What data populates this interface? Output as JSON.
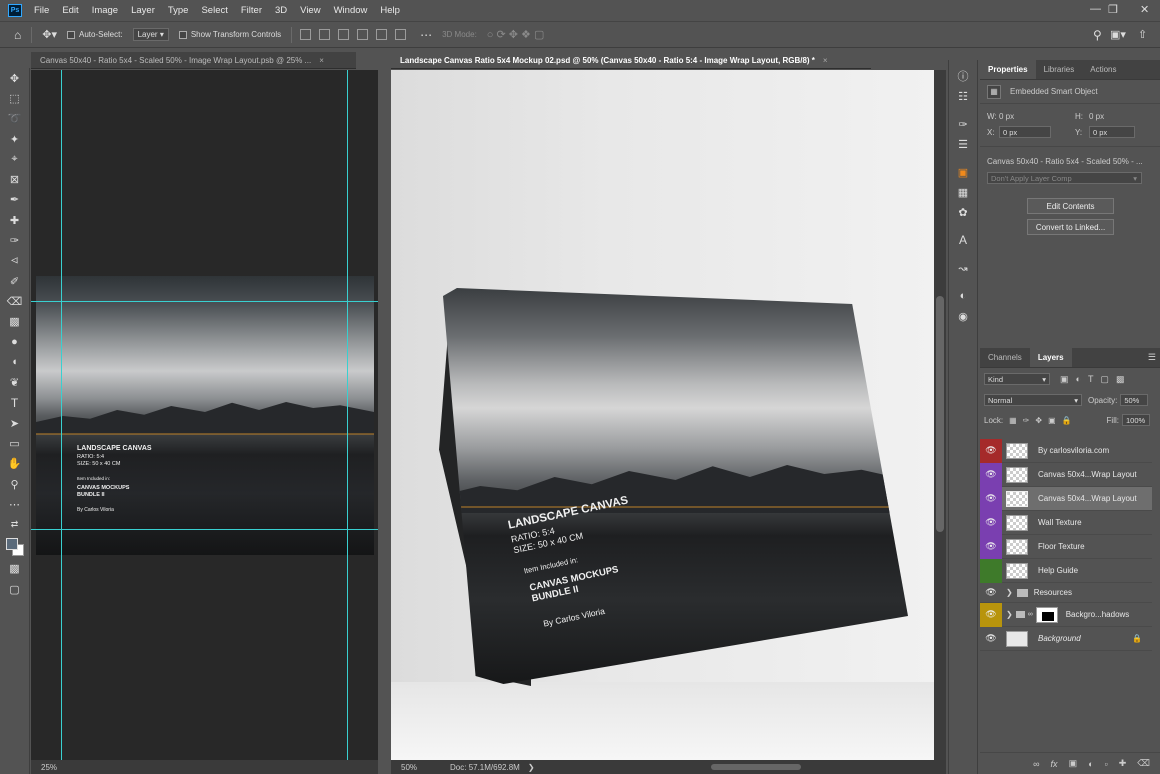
{
  "app": {
    "logo": "Ps"
  },
  "menu": [
    "File",
    "Edit",
    "Image",
    "Layer",
    "Type",
    "Select",
    "Filter",
    "3D",
    "View",
    "Window",
    "Help"
  ],
  "options": {
    "auto_select_label": "Auto-Select:",
    "auto_select_value": "Layer",
    "transform_label": "Show Transform Controls",
    "mode3d": "3D Mode:"
  },
  "doc_left": {
    "tab": "Canvas 50x40 - Ratio 5x4 - Scaled 50% - Image Wrap Layout.psb @ 25% ...",
    "zoom": "25%"
  },
  "doc_main": {
    "tab": "Landscape Canvas Ratio 5x4 Mockup 02.psd @ 50% (Canvas 50x40 - Ratio 5:4 - Image Wrap Layout, RGB/8) *",
    "zoom": "50%",
    "doc_size": "Doc: 57.1M/692.8M"
  },
  "artwork": {
    "title": "LANDSCAPE CANVAS",
    "ratio": "RATIO: 5:4",
    "size": "SIZE: 50 x 40 CM",
    "included": "Item Included in:",
    "bundle1": "CANVAS MOCKUPS",
    "bundle2": "BUNDLE II",
    "author": "By Carlos Viloria"
  },
  "properties": {
    "tabs": [
      "Properties",
      "Libraries",
      "Actions"
    ],
    "type": "Embedded Smart Object",
    "w_label": "W:",
    "w": "0 px",
    "h_label": "H:",
    "h": "0 px",
    "x_label": "X:",
    "x": "0 px",
    "y_label": "Y:",
    "y": "0 px",
    "file": "Canvas 50x40 - Ratio 5x4 - Scaled 50% - ...",
    "layer_comp": "Don't Apply Layer Comp",
    "edit_btn": "Edit Contents",
    "convert_btn": "Convert to Linked..."
  },
  "layers_panel": {
    "tabs": [
      "Channels",
      "Layers"
    ],
    "kind": "Kind",
    "blend": "Normal",
    "opacity_label": "Opacity:",
    "opacity": "50%",
    "lock_label": "Lock:",
    "fill_label": "Fill:",
    "fill": "100%",
    "layers": [
      {
        "name": "By carlosviloria.com",
        "color": "#b02020"
      },
      {
        "name": "Canvas 50x4...Wrap Layout",
        "color": "#7a3fb0"
      },
      {
        "name": "Canvas 50x4...Wrap Layout",
        "color": "#7a3fb0"
      },
      {
        "name": "Wall Texture",
        "color": "#7a3fb0"
      },
      {
        "name": "Floor Texture",
        "color": "#7a3fb0"
      },
      {
        "name": "Help Guide",
        "color": "#3e7a2a"
      },
      {
        "name": "Resources",
        "color": ""
      },
      {
        "name": "Backgro...hadows",
        "color": "#b8940c"
      },
      {
        "name": "Background",
        "color": ""
      }
    ]
  }
}
